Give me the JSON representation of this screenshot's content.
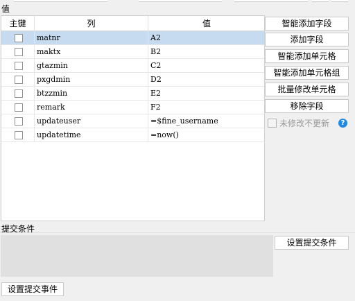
{
  "values_section": {
    "title": "值",
    "columns": {
      "primary_key": "主键",
      "column": "列",
      "value": "值"
    },
    "rows": [
      {
        "column": "matnr",
        "value": "A2",
        "selected": true
      },
      {
        "column": "maktx",
        "value": "B2"
      },
      {
        "column": "gtazmin",
        "value": "C2"
      },
      {
        "column": "pxgdmin",
        "value": "D2"
      },
      {
        "column": "btzzmin",
        "value": "E2"
      },
      {
        "column": "remark",
        "value": "F2"
      },
      {
        "column": "updateuser",
        "value": "=$fine_username"
      },
      {
        "column": "updatetime",
        "value": "=now()"
      }
    ]
  },
  "side_buttons": {
    "smart_add_field": "智能添加字段",
    "add_field": "添加字段",
    "smart_add_cell": "智能添加单元格",
    "smart_add_cell_group": "智能添加单元格组",
    "batch_modify_cell": "批量修改单元格",
    "remove_field": "移除字段"
  },
  "no_update_unchanged": {
    "label": "未修改不更新",
    "checked": false
  },
  "help_icon": "?",
  "submit_condition": {
    "title": "提交条件",
    "set_button": "设置提交条件"
  },
  "submit_event_button": "设置提交事件",
  "colors": {
    "selected_row": "#c6dbef",
    "help_icon": "#1e88e5"
  }
}
